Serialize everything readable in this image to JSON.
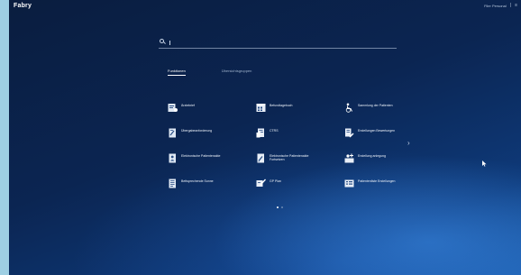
{
  "app": {
    "name": "Fabry",
    "user_name": "Filer Personal"
  },
  "search": {
    "value": "",
    "placeholder": ""
  },
  "tabs": [
    {
      "label": "Funktionen",
      "active": true
    },
    {
      "label": "Übersichtsgruppen",
      "active": false
    }
  ],
  "tiles": [
    {
      "label": "Ärztebrief",
      "icon": "doctor-letter-icon"
    },
    {
      "label": "Befundtagebuch",
      "icon": "calendar-icon"
    },
    {
      "label": "Sammlung der Patienten",
      "icon": "wheelchair-icon"
    },
    {
      "label": "Übergabeanforderung",
      "icon": "transfer-form-icon"
    },
    {
      "label": "CTRS",
      "icon": "drug-list-icon"
    },
    {
      "label": "Erstellungen Bewertungen",
      "icon": "review-edit-icon"
    },
    {
      "label": "Elektronische Patientenakte",
      "icon": "patient-file-icon"
    },
    {
      "label": "Elektronische Patientenakte Fortsetzen",
      "icon": "edit-document-icon"
    },
    {
      "label": "Erstellung anlegung",
      "icon": "add-person-icon"
    },
    {
      "label": "Bettsprechende Sonne",
      "icon": "report-icon"
    },
    {
      "label": "GP Plan",
      "icon": "tablet-pen-icon"
    },
    {
      "label": "Patientenliste Erstellungen",
      "icon": "list-view-icon"
    }
  ],
  "pagination": {
    "count": 2,
    "active": 0
  },
  "colors": {
    "background_dark": "#0a1d3f",
    "background_light": "#1a5aa8",
    "accent": "#ffffff",
    "side_strip": "#9ecfe3"
  }
}
